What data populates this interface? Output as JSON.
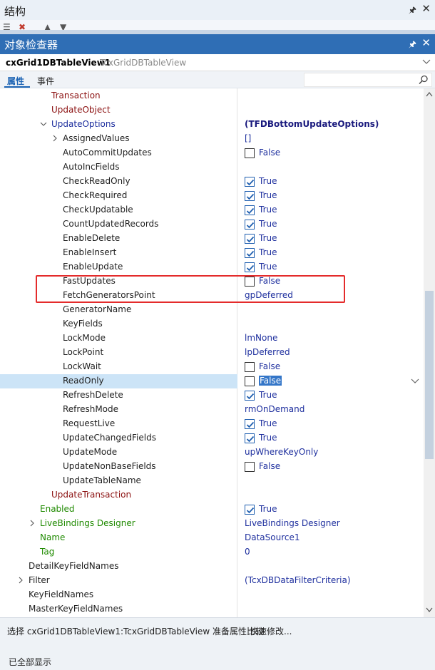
{
  "structure_panel": {
    "title": "结构"
  },
  "inspector": {
    "title": "对象检查器"
  },
  "selector": {
    "component_name": "cxGrid1DBTableView1",
    "component_type": "TcxGridDBTableView"
  },
  "tabs": {
    "properties": "属性",
    "events": "事件"
  },
  "properties": [
    {
      "name": "Transaction",
      "value": "",
      "color": "maroon",
      "indent": 72,
      "checkbox": null,
      "expander": null
    },
    {
      "name": "UpdateObject",
      "value": "",
      "color": "maroon",
      "indent": 72,
      "checkbox": null,
      "expander": null
    },
    {
      "name": "UpdateOptions",
      "value": "(TFDBottomUpdateOptions)",
      "color": "blue",
      "indent": 72,
      "checkbox": null,
      "expander": "open",
      "bold_value": true
    },
    {
      "name": "AssignedValues",
      "value": "[]",
      "color": "dark",
      "indent": 88,
      "checkbox": null,
      "expander": "closed"
    },
    {
      "name": "AutoCommitUpdates",
      "value": "False",
      "color": "dark",
      "indent": 88,
      "checkbox": false,
      "expander": null
    },
    {
      "name": "AutoIncFields",
      "value": "",
      "color": "dark",
      "indent": 88,
      "checkbox": null,
      "expander": null
    },
    {
      "name": "CheckReadOnly",
      "value": "True",
      "color": "dark",
      "indent": 88,
      "checkbox": true,
      "expander": null
    },
    {
      "name": "CheckRequired",
      "value": "True",
      "color": "dark",
      "indent": 88,
      "checkbox": true,
      "expander": null
    },
    {
      "name": "CheckUpdatable",
      "value": "True",
      "color": "dark",
      "indent": 88,
      "checkbox": true,
      "expander": null
    },
    {
      "name": "CountUpdatedRecords",
      "value": "True",
      "color": "dark",
      "indent": 88,
      "checkbox": true,
      "expander": null
    },
    {
      "name": "EnableDelete",
      "value": "True",
      "color": "dark",
      "indent": 88,
      "checkbox": true,
      "expander": null
    },
    {
      "name": "EnableInsert",
      "value": "True",
      "color": "dark",
      "indent": 88,
      "checkbox": true,
      "expander": null
    },
    {
      "name": "EnableUpdate",
      "value": "True",
      "color": "dark",
      "indent": 88,
      "checkbox": true,
      "expander": null
    },
    {
      "name": "FastUpdates",
      "value": "False",
      "color": "dark",
      "indent": 88,
      "checkbox": false,
      "expander": null
    },
    {
      "name": "FetchGeneratorsPoint",
      "value": "gpDeferred",
      "color": "dark",
      "indent": 88,
      "checkbox": null,
      "expander": null
    },
    {
      "name": "GeneratorName",
      "value": "",
      "color": "dark",
      "indent": 88,
      "checkbox": null,
      "expander": null
    },
    {
      "name": "KeyFields",
      "value": "",
      "color": "dark",
      "indent": 88,
      "checkbox": null,
      "expander": null
    },
    {
      "name": "LockMode",
      "value": "lmNone",
      "color": "dark",
      "indent": 88,
      "checkbox": null,
      "expander": null
    },
    {
      "name": "LockPoint",
      "value": "lpDeferred",
      "color": "dark",
      "indent": 88,
      "checkbox": null,
      "expander": null
    },
    {
      "name": "LockWait",
      "value": "False",
      "color": "dark",
      "indent": 88,
      "checkbox": false,
      "expander": null
    },
    {
      "name": "ReadOnly",
      "value": "False",
      "color": "dark",
      "indent": 88,
      "checkbox": false,
      "expander": null,
      "selected": true
    },
    {
      "name": "RefreshDelete",
      "value": "True",
      "color": "dark",
      "indent": 88,
      "checkbox": true,
      "expander": null
    },
    {
      "name": "RefreshMode",
      "value": "rmOnDemand",
      "color": "dark",
      "indent": 88,
      "checkbox": null,
      "expander": null
    },
    {
      "name": "RequestLive",
      "value": "True",
      "color": "dark",
      "indent": 88,
      "checkbox": true,
      "expander": null
    },
    {
      "name": "UpdateChangedFields",
      "value": "True",
      "color": "dark",
      "indent": 88,
      "checkbox": true,
      "expander": null
    },
    {
      "name": "UpdateMode",
      "value": "upWhereKeyOnly",
      "color": "dark",
      "indent": 88,
      "checkbox": null,
      "expander": null
    },
    {
      "name": "UpdateNonBaseFields",
      "value": "False",
      "color": "dark",
      "indent": 88,
      "checkbox": false,
      "expander": null
    },
    {
      "name": "UpdateTableName",
      "value": "",
      "color": "dark",
      "indent": 88,
      "checkbox": null,
      "expander": null
    },
    {
      "name": "UpdateTransaction",
      "value": "",
      "color": "maroon",
      "indent": 72,
      "checkbox": null,
      "expander": null
    },
    {
      "name": "Enabled",
      "value": "True",
      "color": "green",
      "indent": 56,
      "checkbox": true,
      "expander": null
    },
    {
      "name": "LiveBindings Designer",
      "value": "LiveBindings Designer",
      "color": "green",
      "indent": 56,
      "checkbox": null,
      "expander": "closed"
    },
    {
      "name": "Name",
      "value": "DataSource1",
      "color": "green",
      "indent": 56,
      "checkbox": null,
      "expander": null
    },
    {
      "name": "Tag",
      "value": "0",
      "color": "green",
      "indent": 56,
      "checkbox": null,
      "expander": null
    },
    {
      "name": "DetailKeyFieldNames",
      "value": "",
      "color": "dark",
      "indent": 40,
      "checkbox": null,
      "expander": null
    },
    {
      "name": "Filter",
      "value": "(TcxDBDataFilterCriteria)",
      "color": "dark",
      "indent": 40,
      "checkbox": null,
      "expander": "closed"
    },
    {
      "name": "KeyFieldNames",
      "value": "",
      "color": "dark",
      "indent": 40,
      "checkbox": null,
      "expander": null
    },
    {
      "name": "MasterKeyFieldNames",
      "value": "",
      "color": "dark",
      "indent": 40,
      "checkbox": null,
      "expander": null
    }
  ],
  "status": {
    "description": "选择 cxGrid1DBTableView1:TcxGridDBTableView 准备属性比较",
    "quick_edit": "快速修改...",
    "show_all": "已全部显示"
  },
  "colors": {
    "title_bar": "#2f6eb5",
    "selected_row": "#cce4f7",
    "highlight_box": "#e42b2b",
    "value_text": "#1e2f9e"
  }
}
